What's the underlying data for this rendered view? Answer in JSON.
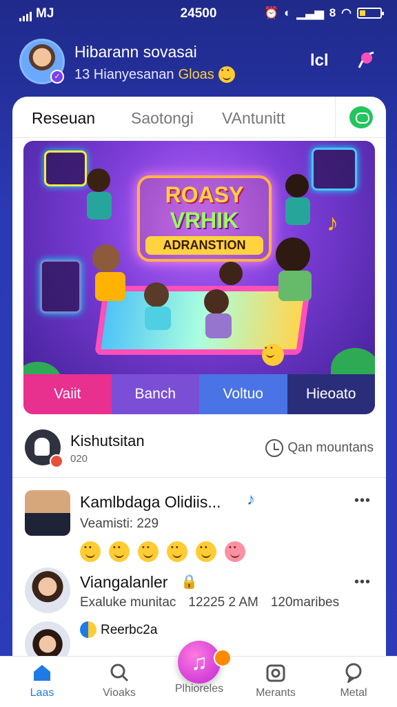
{
  "status_bar": {
    "carrier": "MJ",
    "time": "24500",
    "icons": [
      "alarm-icon",
      "nfc-icon",
      "signal-icon",
      "wifi-icon",
      "battery-icon"
    ],
    "signal_label": "8"
  },
  "header": {
    "title": "Hibarann sovasai",
    "subtitle": "13 Hianyesanan",
    "subtitle_accent": "Gloas",
    "action_label": "lcl"
  },
  "tabs": [
    {
      "label": "Reseuan",
      "active": true
    },
    {
      "label": "Saotongi",
      "active": false
    },
    {
      "label": "VAntunitt",
      "active": false
    }
  ],
  "banner": {
    "title_line1": "ROASY",
    "title_line2": "VRHIK",
    "title_line3": "ADRANSTION",
    "actions": [
      {
        "label": "Vaiit",
        "color": "#e8308e"
      },
      {
        "label": "Banch",
        "color": "#7a4fd6"
      },
      {
        "label": "Voltuo",
        "color": "#4a74e6"
      },
      {
        "label": "Hieoato",
        "color": "#2a2e7a"
      }
    ]
  },
  "featured": {
    "name": "Kishutsitan",
    "sub": "020",
    "right_label": "Qan mountans"
  },
  "rows": [
    {
      "name": "Kamlbdaga Olidiis...",
      "meta": "Veamisti: 229",
      "emoji_count": 6
    },
    {
      "name": "Viangalanler",
      "meta_left": "Exaluke munitac",
      "meta_mid": "12225 2 AM",
      "meta_right": "120maribes"
    },
    {
      "name": "Reerbc2a"
    }
  ],
  "nav": [
    {
      "label": "Laas",
      "icon": "home-icon",
      "active": true
    },
    {
      "label": "Vioaks",
      "icon": "search-icon",
      "active": false
    },
    {
      "label": "Plhioreles",
      "icon": "music-note-icon",
      "active": false
    },
    {
      "label": "Merants",
      "icon": "camera-icon",
      "active": false
    },
    {
      "label": "Metal",
      "icon": "chat-bubble-icon",
      "active": false
    }
  ],
  "colors": {
    "background": "#2b39b4",
    "accent_blue": "#1e7be6",
    "fab": "#c026d3",
    "chat_green": "#22c55e"
  }
}
